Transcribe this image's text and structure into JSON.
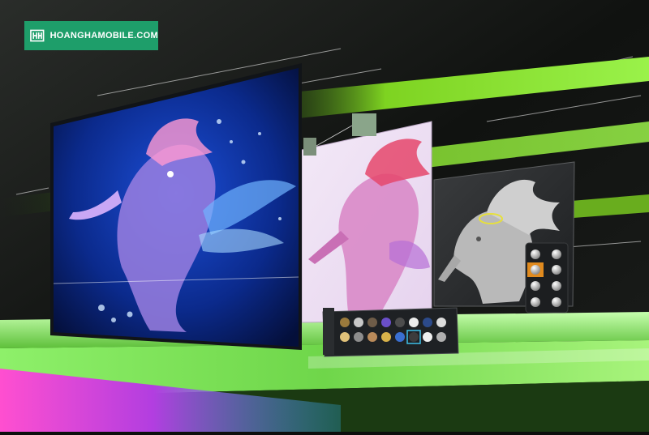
{
  "brand": {
    "text": "HOANGHAMOBILE.COM",
    "logo_icon": "hh-logo-icon",
    "badge_color": "#1e9e6a"
  },
  "colors": {
    "background": "#0d0f0d",
    "accent_green": "#7ed321",
    "shelf_green": "#6fd64a",
    "magenta": "#d93ab8"
  },
  "panels": [
    {
      "name": "rendered-seahorse-screen",
      "style": "full-color render"
    },
    {
      "name": "ai-denoise-preview-screen",
      "style": "pink preview"
    },
    {
      "name": "clay-sculpt-screen",
      "style": "grey sculpt"
    }
  ],
  "material_palette": {
    "swatch_count": 16
  },
  "node_palette": {
    "node_count": 8
  }
}
